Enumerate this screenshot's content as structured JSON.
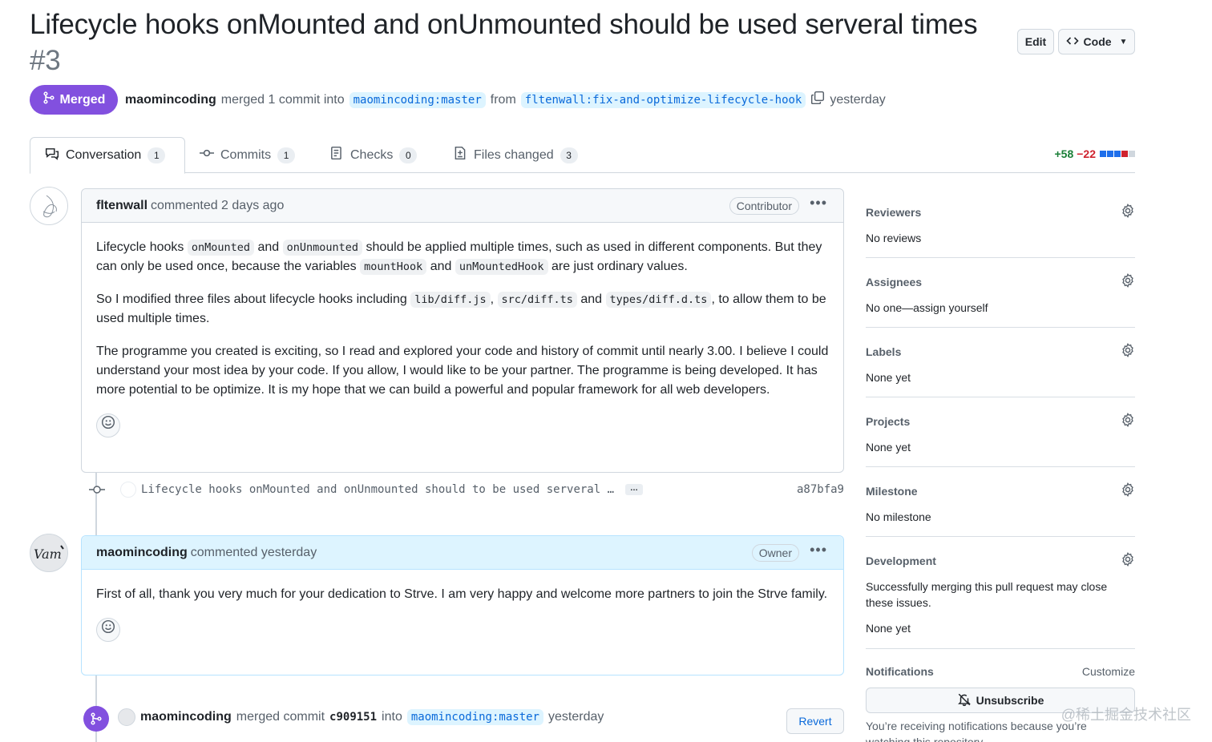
{
  "pr": {
    "title": "Lifecycle hooks onMounted and onUnmounted should be used serveral times",
    "number": "#3",
    "state": "Merged",
    "merger": "maomincoding",
    "merge_text": "merged 1 commit into",
    "base_branch": "maomincoding:master",
    "from_text": "from",
    "head_branch": "fltenwall:fix-and-optimize-lifecycle-hook",
    "when": "yesterday"
  },
  "header_buttons": {
    "edit": "Edit",
    "code": "Code"
  },
  "tabs": [
    {
      "label": "Conversation",
      "count": "1"
    },
    {
      "label": "Commits",
      "count": "1"
    },
    {
      "label": "Checks",
      "count": "0"
    },
    {
      "label": "Files changed",
      "count": "3"
    }
  ],
  "diffstat": {
    "additions": "+58",
    "deletions": "−22",
    "colors": [
      "#1f6feb",
      "#1f6feb",
      "#1f6feb",
      "#cf222e",
      "#d0d7de"
    ]
  },
  "comment1": {
    "author": "fltenwall",
    "action": "commented 2 days ago",
    "role": "Contributor",
    "p1": [
      "Lifecycle hooks ",
      "onMounted",
      " and ",
      "onUnmounted",
      " should be applied multiple times, such as used in different components. But they can only be used once, because the variables ",
      "mountHook",
      " and ",
      "unMountedHook",
      " are just ordinary values."
    ],
    "p2": [
      "So I modified three files about lifecycle hooks including ",
      "lib/diff.js",
      ", ",
      "src/diff.ts",
      " and ",
      "types/diff.d.ts",
      ", to allow them to be used multiple times."
    ],
    "p3": "The programme you created is exciting, so I read and explored your code and history of commit until nearly 3.00. I believe I could understand your most idea by your code. If you allow, I would like to be your partner. The programme is being developed. It has more potential to be optimize. It is my hope that we can build a powerful and popular framework for all web developers."
  },
  "commit": {
    "message": "Lifecycle hooks onMounted and onUnmounted should to be used serveral …",
    "ellipsis": "…",
    "sha": "a87bfa9"
  },
  "comment2": {
    "author": "maomincoding",
    "action": "commented yesterday",
    "role": "Owner",
    "p1": "First of all, thank you very much for your dedication to Strve. I am very happy and welcome more partners to join the Strve family."
  },
  "merge_event": {
    "author": "maomincoding",
    "text1": "merged commit",
    "sha": "c909151",
    "text2": "into",
    "branch": "maomincoding:master",
    "when": "yesterday",
    "revert": "Revert"
  },
  "sidebar": {
    "reviewers": {
      "title": "Reviewers",
      "value": "No reviews"
    },
    "assignees": {
      "title": "Assignees",
      "value": "No one—assign yourself"
    },
    "labels": {
      "title": "Labels",
      "value": "None yet"
    },
    "projects": {
      "title": "Projects",
      "value": "None yet"
    },
    "milestone": {
      "title": "Milestone",
      "value": "No milestone"
    },
    "development": {
      "title": "Development",
      "desc": "Successfully merging this pull request may close these issues.",
      "value": "None yet"
    },
    "notifications": {
      "title": "Notifications",
      "customize": "Customize",
      "unsubscribe": "Unsubscribe",
      "reason": "You’re receiving notifications because you’re watching this repository."
    }
  },
  "watermark": "@稀土掘金技术社区",
  "colors": {
    "merged": "#8250df",
    "link": "#0969da",
    "owner_bg": "#ddf4ff"
  }
}
